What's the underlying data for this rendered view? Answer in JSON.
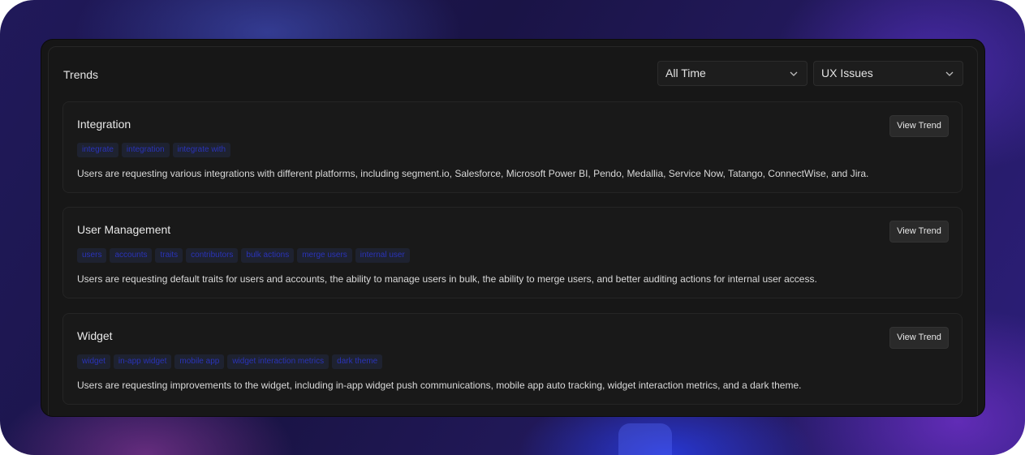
{
  "header": {
    "title": "Trends",
    "time_filter": "All Time",
    "type_filter": "UX Issues"
  },
  "trends": [
    {
      "title": "Integration",
      "button": "View Trend",
      "tags": [
        "integrate",
        "integration",
        "integrate with"
      ],
      "description": "Users are requesting various integrations with different platforms, including segment.io, Salesforce, Microsoft Power BI, Pendo, Medallia, Service Now, Tatango, ConnectWise, and Jira."
    },
    {
      "title": "User Management",
      "button": "View Trend",
      "tags": [
        "users",
        "accounts",
        "traits",
        "contributors",
        "bulk actions",
        "merge users",
        "internal user"
      ],
      "description": "Users are requesting default traits for users and accounts, the ability to manage users in bulk, the ability to merge users, and better auditing actions for internal user access."
    },
    {
      "title": "Widget",
      "button": "View Trend",
      "tags": [
        "widget",
        "in-app widget",
        "mobile app",
        "widget interaction metrics",
        "dark theme"
      ],
      "description": "Users are requesting improvements to the widget, including in-app widget push communications, mobile app auto tracking, widget interaction metrics, and a dark theme."
    }
  ],
  "icons": {
    "dropdown": "chevron-down-icon"
  },
  "colors": {
    "panel": "#161616",
    "tag_text": "#2a33b8",
    "tag_bg": "#1e2230"
  }
}
